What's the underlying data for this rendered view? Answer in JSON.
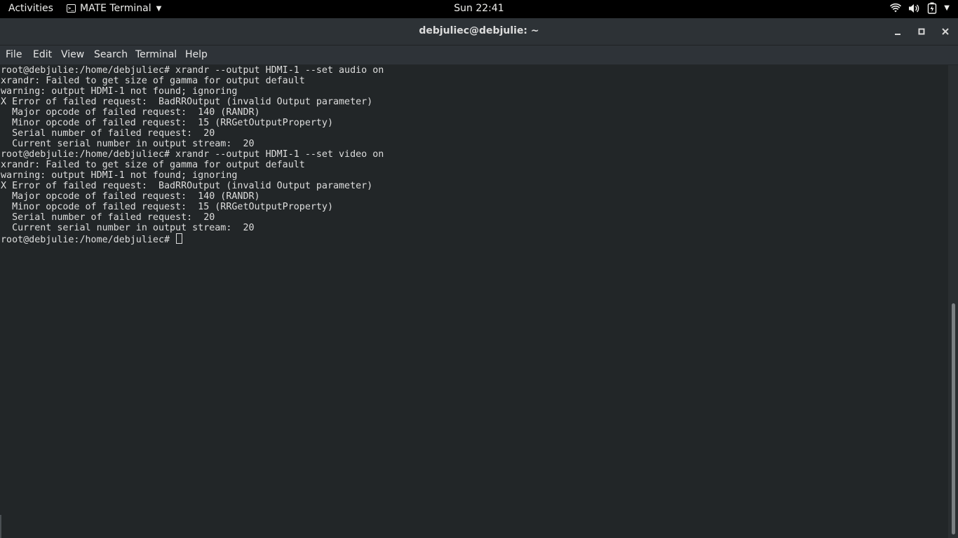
{
  "topbar": {
    "activities": "Activities",
    "app_name": "MATE Terminal",
    "clock": "Sun 22:41",
    "tray_icons": [
      "wifi-icon",
      "volume-icon",
      "battery-icon",
      "system-menu-caret-icon"
    ]
  },
  "window": {
    "title": "debjuliec@debjulie: ~",
    "controls": [
      "minimize",
      "maximize",
      "close"
    ]
  },
  "menu": {
    "items": [
      "File",
      "Edit",
      "View",
      "Search",
      "Terminal",
      "Help"
    ]
  },
  "terminal": {
    "lines": [
      "root@debjulie:/home/debjuliec# xrandr --output HDMI-1 --set audio on",
      "xrandr: Failed to get size of gamma for output default",
      "warning: output HDMI-1 not found; ignoring",
      "X Error of failed request:  BadRROutput (invalid Output parameter)",
      "  Major opcode of failed request:  140 (RANDR)",
      "  Minor opcode of failed request:  15 (RRGetOutputProperty)",
      "  Serial number of failed request:  20",
      "  Current serial number in output stream:  20",
      "root@debjulie:/home/debjuliec# xrandr --output HDMI-1 --set video on",
      "xrandr: Failed to get size of gamma for output default",
      "warning: output HDMI-1 not found; ignoring",
      "X Error of failed request:  BadRROutput (invalid Output parameter)",
      "  Major opcode of failed request:  140 (RANDR)",
      "  Minor opcode of failed request:  15 (RRGetOutputProperty)",
      "  Serial number of failed request:  20",
      "  Current serial number in output stream:  20"
    ],
    "prompt": "root@debjulie:/home/debjuliec# "
  },
  "colors": {
    "topbar_bg": "#000000",
    "header_bg": "#2d3236",
    "terminal_bg": "#222628",
    "text": "#dedede"
  }
}
